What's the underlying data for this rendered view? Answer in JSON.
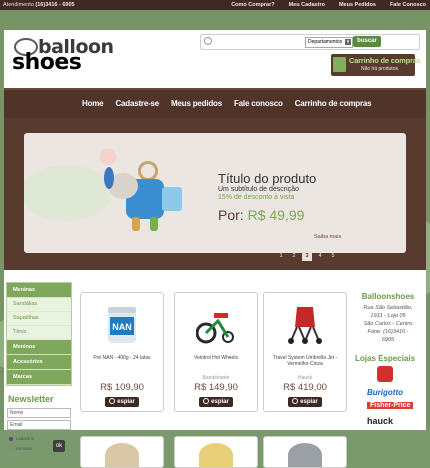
{
  "topbar": {
    "phone_label": "Atendimento",
    "phone": "(16)3416 - 6905",
    "links": [
      "Como Comprar?",
      "Meu Cadastro",
      "Meus Pedidos",
      "Fale Conosco"
    ]
  },
  "logo": {
    "top": "balloon",
    "bottom": "shoes"
  },
  "search": {
    "placeholder": "",
    "department": "Departamentos",
    "button": "buscar"
  },
  "cart": {
    "title": "Carrinho de compras",
    "status": "Não há produtos."
  },
  "nav": [
    "Home",
    "Cadastre-se",
    "Meus pedidos",
    "Fale conosco",
    "Carrinho de compras"
  ],
  "banner": {
    "title": "Título do produto",
    "subtitle": "Um subtítulo de descrição",
    "discount": "15% de desconto à vista",
    "price_prefix": "Por:",
    "price": "R$ 49,99",
    "more": "Saiba mais",
    "pages": [
      "1",
      "2",
      "3",
      "4",
      "5"
    ],
    "active_page": "3"
  },
  "sidebar": {
    "categories": [
      {
        "label": "Meninas",
        "type": "main"
      },
      {
        "label": "Sandálias",
        "type": "sub"
      },
      {
        "label": "Sapatilhas",
        "type": "sub"
      },
      {
        "label": "Tênis",
        "type": "sub"
      },
      {
        "label": "Meninos",
        "type": "main"
      },
      {
        "label": "Acessórios",
        "type": "main"
      },
      {
        "label": "Marcas",
        "type": "main"
      }
    ],
    "newsletter": {
      "title": "Newsletter",
      "name_placeholder": "Nome",
      "email_placeholder": "Email",
      "options": [
        "cadastrar",
        "remover"
      ],
      "ok": "ok"
    }
  },
  "products": [
    {
      "name": "Pré NAN - 400g - 24 latas",
      "brand": "",
      "price": "R$ 109,90",
      "button": "espiar"
    },
    {
      "name": "Velotrol Hot Wheels",
      "brand": "Bandeirante",
      "price": "R$ 149,90",
      "button": "espiar"
    },
    {
      "name": "Travel System Umbrella Jet - Vermelho-Cinza",
      "brand": "Hauck",
      "price": "R$ 419,00",
      "button": "espiar"
    }
  ],
  "store": {
    "name": "Balloonshoes",
    "address": [
      "Rua São Sebastião,",
      "1931 - Loja 05",
      "São Carlos - Centro",
      "Fone: (16)3416 -",
      "6905"
    ],
    "stores_title": "Lojas Especiais",
    "brands": [
      "Bandeirante",
      "Burigotto",
      "Fisher-Price",
      "hauck"
    ]
  },
  "colors": {
    "brown": "#503329",
    "green": "#6d9a49",
    "page_bg": "#769466"
  }
}
